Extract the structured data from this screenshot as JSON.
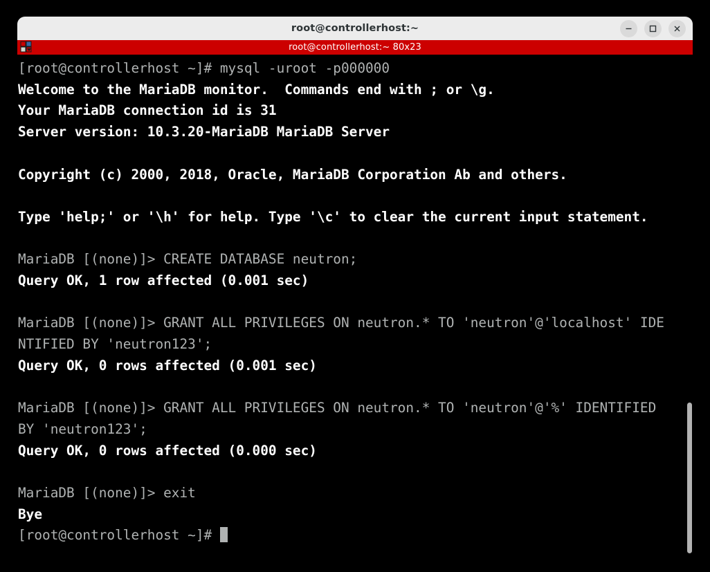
{
  "window": {
    "title": "root@controllerhost:~",
    "controls": [
      {
        "name": "minimize-button",
        "glyph": "minimize-icon"
      },
      {
        "name": "maximize-button",
        "glyph": "maximize-icon"
      },
      {
        "name": "close-button",
        "glyph": "close-icon"
      }
    ]
  },
  "tabbar": {
    "new_tab_icon": "new-tab-dropdown-icon",
    "tab_title": "root@controllerhost:~ 80x23",
    "accent_color": "#cc0000"
  },
  "terminal": {
    "columns": 80,
    "rows": 23,
    "background_color": "#000000",
    "foreground_color": "#b0b3b3",
    "bold_color": "#ffffff",
    "cursor": "block",
    "lines": [
      {
        "text": "[root@controllerhost ~]# mysql -uroot -p000000",
        "style": "dim"
      },
      {
        "text": "Welcome to the MariaDB monitor.  Commands end with ; or \\g.",
        "style": "bold"
      },
      {
        "text": "Your MariaDB connection id is 31",
        "style": "bold"
      },
      {
        "text": "Server version: 10.3.20-MariaDB MariaDB Server",
        "style": "bold"
      },
      {
        "text": "",
        "style": "blank"
      },
      {
        "text": "Copyright (c) 2000, 2018, Oracle, MariaDB Corporation Ab and others.",
        "style": "bold"
      },
      {
        "text": "",
        "style": "blank"
      },
      {
        "text": "Type 'help;' or '\\h' for help. Type '\\c' to clear the current input statement.",
        "style": "bold"
      },
      {
        "text": "",
        "style": "blank"
      },
      {
        "text": "MariaDB [(none)]> CREATE DATABASE neutron;",
        "style": "dim"
      },
      {
        "text": "Query OK, 1 row affected (0.001 sec)",
        "style": "bold"
      },
      {
        "text": "",
        "style": "blank"
      },
      {
        "text": "MariaDB [(none)]> GRANT ALL PRIVILEGES ON neutron.* TO 'neutron'@'localhost' IDE",
        "style": "dim"
      },
      {
        "text": "NTIFIED BY 'neutron123';",
        "style": "dim"
      },
      {
        "text": "Query OK, 0 rows affected (0.001 sec)",
        "style": "bold"
      },
      {
        "text": "",
        "style": "blank"
      },
      {
        "text": "MariaDB [(none)]> GRANT ALL PRIVILEGES ON neutron.* TO 'neutron'@'%' IDENTIFIED",
        "style": "dim"
      },
      {
        "text": "BY 'neutron123';",
        "style": "dim"
      },
      {
        "text": "Query OK, 0 rows affected (0.000 sec)",
        "style": "bold"
      },
      {
        "text": "",
        "style": "blank"
      },
      {
        "text": "MariaDB [(none)]> exit",
        "style": "dim"
      },
      {
        "text": "Bye",
        "style": "bold"
      },
      {
        "text": "[root@controllerhost ~]# ",
        "style": "dim",
        "cursor": true
      }
    ]
  },
  "scrollbar": {
    "name": "vertical-scrollbar",
    "thumb_color": "#b3b3b3"
  }
}
